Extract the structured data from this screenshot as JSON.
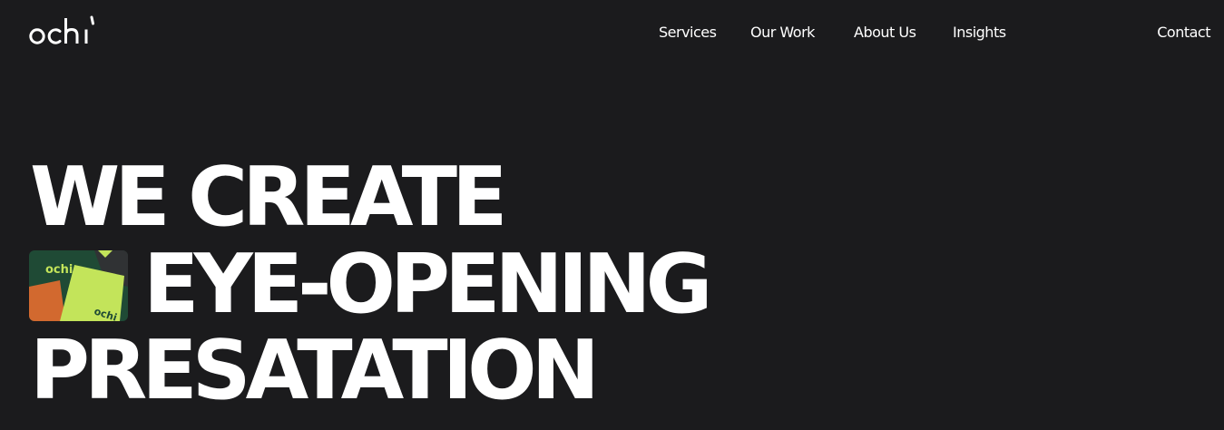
{
  "header": {
    "logo_text": "ochi",
    "nav": [
      {
        "label": "Services"
      },
      {
        "label": "Our Work"
      },
      {
        "label": "About Us"
      },
      {
        "label": "Insights"
      },
      {
        "label": "Contact"
      }
    ]
  },
  "hero": {
    "lines": [
      "WE CREATE",
      "EYE-OPENING",
      "PRESATATION"
    ],
    "thumbnail": {
      "logo_text": "ochi",
      "colors": {
        "background": "#1f4a35",
        "card_lime": "#c3e45a",
        "card_orange": "#d2692f",
        "card_dark": "#303234"
      }
    }
  },
  "colors": {
    "page_background": "#1b1b1d",
    "text": "#ffffff"
  }
}
